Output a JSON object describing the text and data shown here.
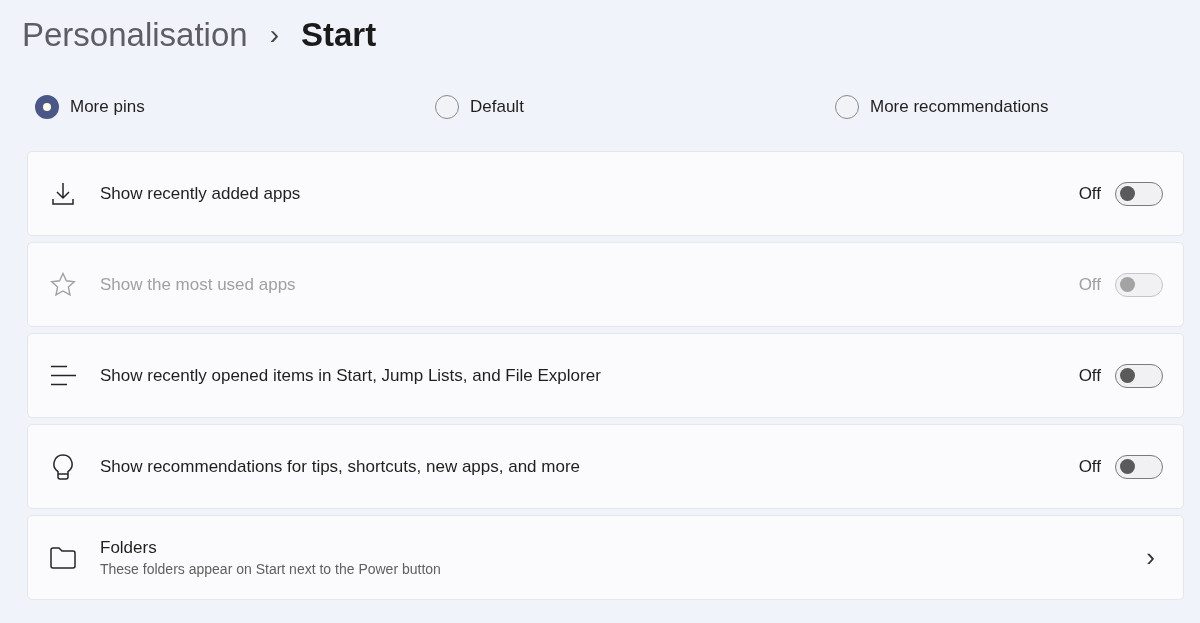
{
  "breadcrumb": {
    "parent": "Personalisation",
    "separator": "›",
    "current": "Start"
  },
  "layout_options": [
    {
      "label": "More pins",
      "selected": true
    },
    {
      "label": "Default",
      "selected": false
    },
    {
      "label": "More recommendations",
      "selected": false
    }
  ],
  "settings": [
    {
      "kind": "toggle",
      "label": "Show recently added apps",
      "state_text": "Off",
      "on": false,
      "disabled": false
    },
    {
      "kind": "toggle",
      "label": "Show the most used apps",
      "state_text": "Off",
      "on": false,
      "disabled": true
    },
    {
      "kind": "toggle",
      "label": "Show recently opened items in Start, Jump Lists, and File Explorer",
      "state_text": "Off",
      "on": false,
      "disabled": false
    },
    {
      "kind": "toggle",
      "label": "Show recommendations for tips, shortcuts, new apps, and more",
      "state_text": "Off",
      "on": false,
      "disabled": false
    },
    {
      "kind": "link",
      "label": "Folders",
      "description": "These folders appear on Start next to the Power button",
      "chevron": "›"
    }
  ]
}
